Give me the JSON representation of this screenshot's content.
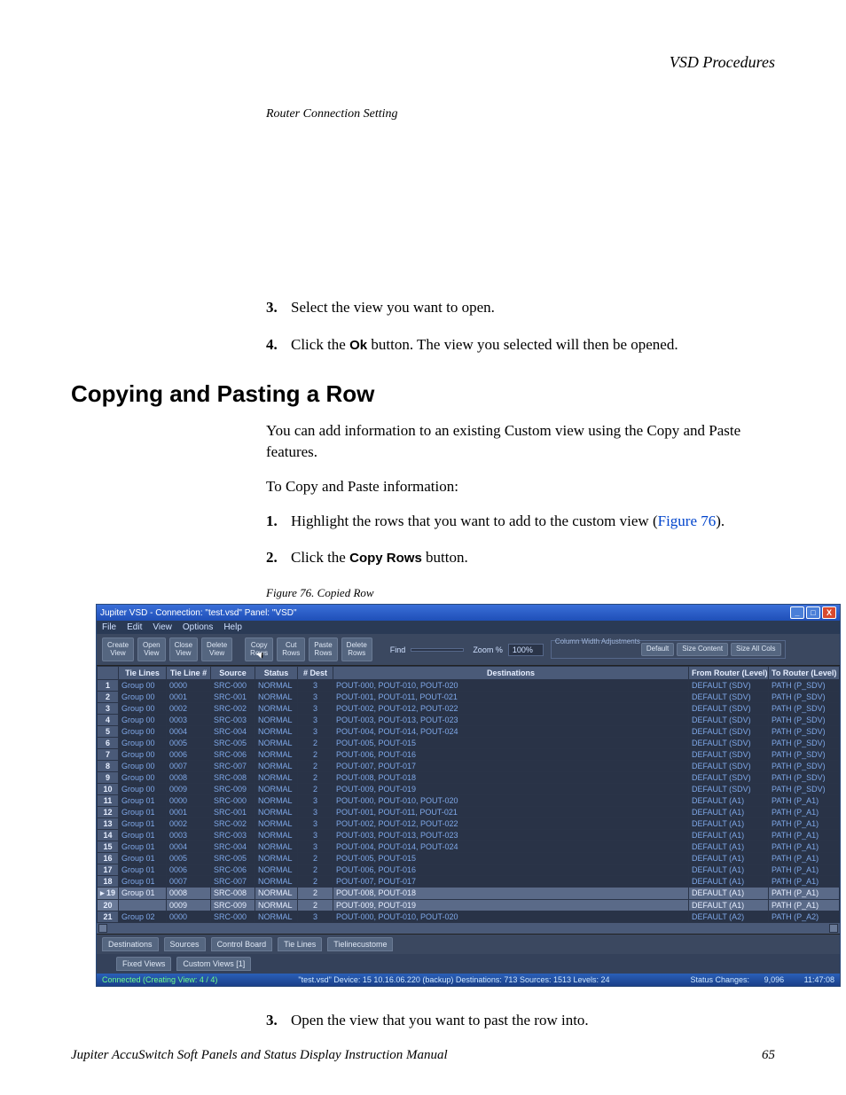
{
  "page_header": "VSD Procedures",
  "router_caption": "Router Connection Setting",
  "steps_open": {
    "s3": "Select the view you want to open.",
    "s4_pre": "Click the ",
    "s4_bold": "Ok",
    "s4_post": " button. The view you selected will then be opened."
  },
  "section_heading": "Copying and Pasting a Row",
  "paragraph1": "You can add information to an existing Custom view using the Copy and Paste features.",
  "paragraph2": "To Copy and Paste information:",
  "steps_copy": {
    "s1_pre": "Highlight the rows that you want to add to the custom view (",
    "s1_link": "Figure 76",
    "s1_post": ").",
    "s2_pre": "Click the ",
    "s2_bold": "Copy Rows",
    "s2_post": " button.",
    "s3": "Open the view that you want to past the row into."
  },
  "figure_caption": "Figure 76.  Copied Row",
  "footer_left": "Jupiter AccuSwitch Soft Panels and Status Display Instruction Manual",
  "footer_right": "65",
  "app": {
    "title": "Jupiter VSD - Connection: \"test.vsd\"  Panel: \"VSD\"",
    "menus": [
      "File",
      "Edit",
      "View",
      "Options",
      "Help"
    ],
    "toolbar": {
      "create_view": "Create\nView",
      "open_view": "Open\nView",
      "close_view": "Close\nView",
      "delete_view": "Delete\nView",
      "copy_rows": "Copy\nRows",
      "cut_rows": "Cut\nRows",
      "paste_rows": "Paste\nRows",
      "delete_rows": "Delete\nRows",
      "find_label": "Find",
      "find_value": "",
      "zoom_label": "Zoom %",
      "zoom_value": "100%",
      "col_group_title": "Column Width Adjustments",
      "col_default": "Default",
      "col_sizecontent": "Size Content",
      "col_sizeall": "Size All Cols"
    },
    "columns": [
      "",
      "Tie Lines",
      "Tie Line #",
      "Source",
      "Status",
      "# Dest",
      "Destinations",
      "From Router (Level)",
      "To Router (Level)"
    ],
    "rows": [
      {
        "n": 1,
        "g": "Group 00",
        "t": "0000",
        "s": "SRC-000",
        "st": "NORMAL",
        "nd": "3",
        "d": "POUT-000,  POUT-010,  POUT-020",
        "fr": "DEFAULT (SDV)",
        "to": "PATH (P_SDV)"
      },
      {
        "n": 2,
        "g": "Group 00",
        "t": "0001",
        "s": "SRC-001",
        "st": "NORMAL",
        "nd": "3",
        "d": "POUT-001,  POUT-011,  POUT-021",
        "fr": "DEFAULT (SDV)",
        "to": "PATH (P_SDV)"
      },
      {
        "n": 3,
        "g": "Group 00",
        "t": "0002",
        "s": "SRC-002",
        "st": "NORMAL",
        "nd": "3",
        "d": "POUT-002,  POUT-012,  POUT-022",
        "fr": "DEFAULT (SDV)",
        "to": "PATH (P_SDV)"
      },
      {
        "n": 4,
        "g": "Group 00",
        "t": "0003",
        "s": "SRC-003",
        "st": "NORMAL",
        "nd": "3",
        "d": "POUT-003,  POUT-013,  POUT-023",
        "fr": "DEFAULT (SDV)",
        "to": "PATH (P_SDV)"
      },
      {
        "n": 5,
        "g": "Group 00",
        "t": "0004",
        "s": "SRC-004",
        "st": "NORMAL",
        "nd": "3",
        "d": "POUT-004,  POUT-014,  POUT-024",
        "fr": "DEFAULT (SDV)",
        "to": "PATH (P_SDV)"
      },
      {
        "n": 6,
        "g": "Group 00",
        "t": "0005",
        "s": "SRC-005",
        "st": "NORMAL",
        "nd": "2",
        "d": "POUT-005,  POUT-015",
        "fr": "DEFAULT (SDV)",
        "to": "PATH (P_SDV)"
      },
      {
        "n": 7,
        "g": "Group 00",
        "t": "0006",
        "s": "SRC-006",
        "st": "NORMAL",
        "nd": "2",
        "d": "POUT-006,  POUT-016",
        "fr": "DEFAULT (SDV)",
        "to": "PATH (P_SDV)"
      },
      {
        "n": 8,
        "g": "Group 00",
        "t": "0007",
        "s": "SRC-007",
        "st": "NORMAL",
        "nd": "2",
        "d": "POUT-007,  POUT-017",
        "fr": "DEFAULT (SDV)",
        "to": "PATH (P_SDV)"
      },
      {
        "n": 9,
        "g": "Group 00",
        "t": "0008",
        "s": "SRC-008",
        "st": "NORMAL",
        "nd": "2",
        "d": "POUT-008,  POUT-018",
        "fr": "DEFAULT (SDV)",
        "to": "PATH (P_SDV)"
      },
      {
        "n": 10,
        "g": "Group 00",
        "t": "0009",
        "s": "SRC-009",
        "st": "NORMAL",
        "nd": "2",
        "d": "POUT-009,  POUT-019",
        "fr": "DEFAULT (SDV)",
        "to": "PATH (P_SDV)"
      },
      {
        "n": 11,
        "g": "Group 01",
        "t": "0000",
        "s": "SRC-000",
        "st": "NORMAL",
        "nd": "3",
        "d": "POUT-000,  POUT-010,  POUT-020",
        "fr": "DEFAULT (A1)",
        "to": "PATH (P_A1)"
      },
      {
        "n": 12,
        "g": "Group 01",
        "t": "0001",
        "s": "SRC-001",
        "st": "NORMAL",
        "nd": "3",
        "d": "POUT-001,  POUT-011,  POUT-021",
        "fr": "DEFAULT (A1)",
        "to": "PATH (P_A1)"
      },
      {
        "n": 13,
        "g": "Group 01",
        "t": "0002",
        "s": "SRC-002",
        "st": "NORMAL",
        "nd": "3",
        "d": "POUT-002,  POUT-012,  POUT-022",
        "fr": "DEFAULT (A1)",
        "to": "PATH (P_A1)"
      },
      {
        "n": 14,
        "g": "Group 01",
        "t": "0003",
        "s": "SRC-003",
        "st": "NORMAL",
        "nd": "3",
        "d": "POUT-003,  POUT-013,  POUT-023",
        "fr": "DEFAULT (A1)",
        "to": "PATH (P_A1)"
      },
      {
        "n": 15,
        "g": "Group 01",
        "t": "0004",
        "s": "SRC-004",
        "st": "NORMAL",
        "nd": "3",
        "d": "POUT-004,  POUT-014,  POUT-024",
        "fr": "DEFAULT (A1)",
        "to": "PATH (P_A1)"
      },
      {
        "n": 16,
        "g": "Group 01",
        "t": "0005",
        "s": "SRC-005",
        "st": "NORMAL",
        "nd": "2",
        "d": "POUT-005,  POUT-015",
        "fr": "DEFAULT (A1)",
        "to": "PATH (P_A1)"
      },
      {
        "n": 17,
        "g": "Group 01",
        "t": "0006",
        "s": "SRC-006",
        "st": "NORMAL",
        "nd": "2",
        "d": "POUT-006,  POUT-016",
        "fr": "DEFAULT (A1)",
        "to": "PATH (P_A1)"
      },
      {
        "n": 18,
        "g": "Group 01",
        "t": "0007",
        "s": "SRC-007",
        "st": "NORMAL",
        "nd": "2",
        "d": "POUT-007,  POUT-017",
        "fr": "DEFAULT (A1)",
        "to": "PATH (P_A1)"
      },
      {
        "n": 19,
        "g": "Group 01",
        "t": "0008",
        "s": "SRC-008",
        "st": "NORMAL",
        "nd": "2",
        "d": "POUT-008,  POUT-018",
        "fr": "DEFAULT (A1)",
        "to": "PATH (P_A1)",
        "sel": true,
        "marker": true
      },
      {
        "n": 20,
        "g": "",
        "t": "0009",
        "s": "SRC-009",
        "st": "NORMAL",
        "nd": "2",
        "d": "POUT-009,  POUT-019",
        "fr": "DEFAULT (A1)",
        "to": "PATH (P_A1)",
        "sel": true
      },
      {
        "n": 21,
        "g": "Group 02",
        "t": "0000",
        "s": "SRC-000",
        "st": "NORMAL",
        "nd": "3",
        "d": "POUT-000,  POUT-010,  POUT-020",
        "fr": "DEFAULT (A2)",
        "to": "PATH (P_A2)"
      }
    ],
    "tabs_bottom": [
      "Destinations",
      "Sources",
      "Control Board",
      "Tie Lines",
      "Tielinecustome"
    ],
    "subtabs": [
      "Fixed Views",
      "Custom Views [1]"
    ],
    "status": {
      "left": "Connected (Creating View: 4 / 4)",
      "mid": "\"test.vsd\" Device: 15  10.16.06.220 (backup)     Destinations:   713   Sources:  1513  Levels:  24",
      "changes_label": "Status Changes:",
      "changes_val": "9,096",
      "time": "11:47:08"
    }
  }
}
